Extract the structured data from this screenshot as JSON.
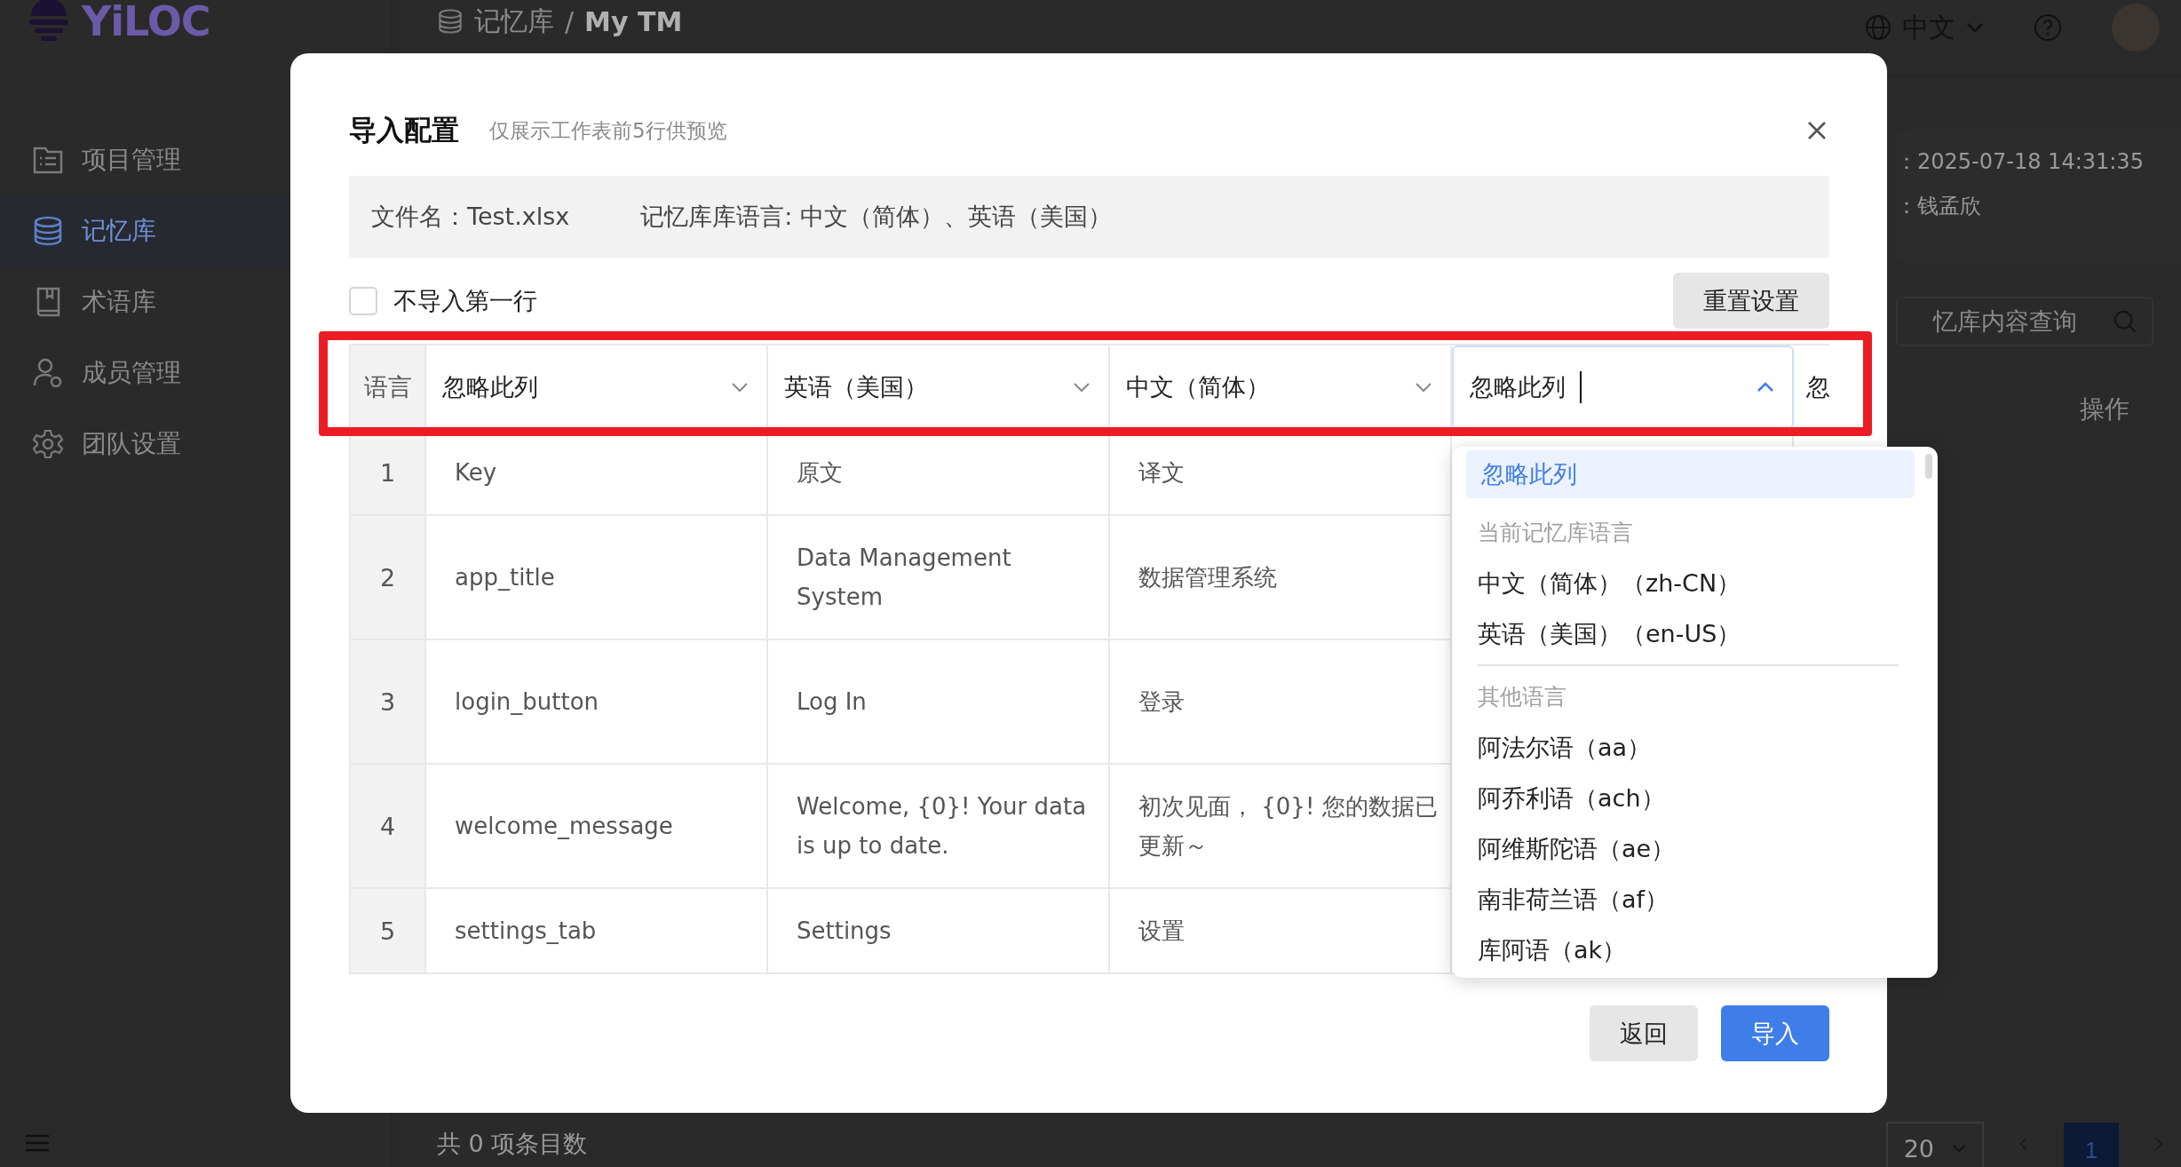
{
  "app": {
    "logo": "YiLOC"
  },
  "sidebar": {
    "items": [
      {
        "label": "项目管理",
        "selected": false
      },
      {
        "label": "记忆库",
        "selected": true
      },
      {
        "label": "术语库",
        "selected": false
      },
      {
        "label": "成员管理",
        "selected": false
      },
      {
        "label": "团队设置",
        "selected": false
      }
    ]
  },
  "topbar": {
    "breadcrumb": [
      "记忆库",
      "/",
      "My TM"
    ],
    "language": "中文"
  },
  "background": {
    "updated": "：2025-07-18 14:31:35",
    "owner": "：钱孟欣",
    "search_placeholder": "忆库内容查询",
    "column_header": "操作"
  },
  "footer": {
    "total": "共 0 项条目数",
    "page_size": "20",
    "pages": [
      {
        "label": "1",
        "selected": true
      }
    ]
  },
  "dialog": {
    "title": "导入配置",
    "hint": "仅展示工作表前5行供预览",
    "file_name": "文件名：Test.xlsx",
    "languages": "记忆库库语言: 中文（简体）、英语（美国）",
    "skip_first_row": {
      "label": "不导入第一行",
      "checked": false
    },
    "reset_button": "重置设置",
    "mapping": {
      "label": "语言",
      "columns": [
        {
          "value": "忽略此列",
          "open": false
        },
        {
          "value": "英语（美国）",
          "open": false
        },
        {
          "value": "中文（简体）",
          "open": false
        },
        {
          "value": "忽略此列",
          "open": true
        },
        {
          "value": "忽",
          "kind": "cut"
        }
      ]
    },
    "rows": [
      {
        "index": "1",
        "cells": [
          "Key",
          "原文",
          "译文"
        ]
      },
      {
        "index": "2",
        "cells": [
          "app_title",
          "Data Management System",
          "数据管理系统"
        ]
      },
      {
        "index": "3",
        "cells": [
          "login_button",
          "Log In",
          "登录"
        ]
      },
      {
        "index": "4",
        "cells": [
          "welcome_message",
          "Welcome, {0}! Your data is up to date.",
          "初次见面， {0}! 您的数据已更新～"
        ]
      },
      {
        "index": "5",
        "cells": [
          "settings_tab",
          "Settings",
          "设置"
        ]
      }
    ],
    "dropdown": [
      {
        "kind": "option",
        "label": "忽略此列",
        "selected": true
      },
      {
        "kind": "group",
        "label": "当前记忆库语言"
      },
      {
        "kind": "option",
        "label": "中文（简体）（zh-CN）",
        "selected": false
      },
      {
        "kind": "option",
        "label": "英语（美国）（en-US）",
        "selected": false
      },
      {
        "kind": "divider"
      },
      {
        "kind": "group",
        "label": "其他语言"
      },
      {
        "kind": "option",
        "label": "阿法尔语（aa）",
        "selected": false
      },
      {
        "kind": "option",
        "label": "阿乔利语（ach）",
        "selected": false
      },
      {
        "kind": "option",
        "label": "阿维斯陀语（ae）",
        "selected": false
      },
      {
        "kind": "option",
        "label": "南非荷兰语（af）",
        "selected": false
      },
      {
        "kind": "option",
        "label": "库阿语（ak）",
        "selected": false
      }
    ],
    "buttons": [
      {
        "label": "返回",
        "kind": "secondary"
      },
      {
        "label": "导入",
        "kind": "primary"
      }
    ]
  }
}
